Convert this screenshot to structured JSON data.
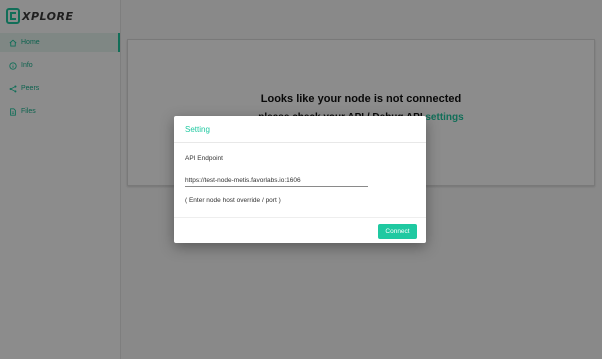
{
  "brand": {
    "logo_letter": "E",
    "name_accent": "E",
    "name_rest": "XPLORE"
  },
  "sidebar": {
    "items": [
      {
        "label": "Home",
        "icon": "home-icon",
        "active": true
      },
      {
        "label": "Info",
        "icon": "info-circle-icon",
        "active": false
      },
      {
        "label": "Peers",
        "icon": "share-nodes-icon",
        "active": false
      },
      {
        "label": "Files",
        "icon": "file-icon",
        "active": false
      }
    ]
  },
  "main": {
    "title": "Looks like your node is not connected",
    "subtitle_prefix": "please check your API / Debug API ",
    "subtitle_link": "settings"
  },
  "modal": {
    "title": "Setting",
    "field_label": "API Endpoint",
    "endpoint_value": "https://test-node-metis.favorlabs.io:1606",
    "hint": "( Enter node host override / port )",
    "connect_label": "Connect"
  },
  "colors": {
    "accent": "#1fc9a1",
    "overlay": "rgba(0,0,0,0.45)"
  }
}
